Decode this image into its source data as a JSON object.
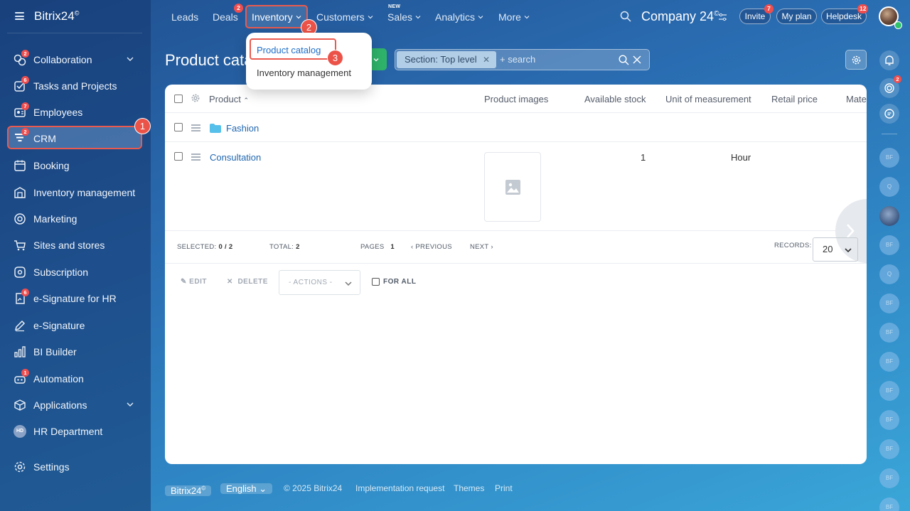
{
  "app": {
    "brand": "Bitrix24",
    "brand_mark": "©"
  },
  "sidebar": {
    "items": [
      {
        "label": "Collaboration",
        "badge": "2",
        "has_chevron": true
      },
      {
        "label": "Tasks and Projects",
        "badge": "6"
      },
      {
        "label": "Employees",
        "badge": "7"
      },
      {
        "label": "CRM",
        "badge": "2",
        "active": true
      },
      {
        "label": "Booking"
      },
      {
        "label": "Inventory management"
      },
      {
        "label": "Marketing"
      },
      {
        "label": "Sites and stores"
      },
      {
        "label": "Subscription"
      },
      {
        "label": "e-Signature for HR",
        "badge": "6"
      },
      {
        "label": "e-Signature"
      },
      {
        "label": "BI Builder"
      },
      {
        "label": "Automation",
        "badge": "1"
      },
      {
        "label": "Applications",
        "has_chevron": true
      },
      {
        "label": "HR Department",
        "avatar": "HD"
      },
      {
        "label": "Settings"
      }
    ]
  },
  "steps": {
    "one": "1",
    "two": "2",
    "three": "3"
  },
  "topnav": {
    "leads": "Leads",
    "deals": "Deals",
    "deals_badge": "2",
    "inventory": "Inventory",
    "customers": "Customers",
    "sales": "Sales",
    "sales_tag": "NEW",
    "analytics": "Analytics",
    "more": "More",
    "company": "Company 24",
    "company_mark": "©",
    "invite": "Invite",
    "invite_badge": "7",
    "my_plan": "My plan",
    "helpdesk": "Helpdesk",
    "helpdesk_badge": "12"
  },
  "dropdown": {
    "items": [
      "Product catalog",
      "Inventory management"
    ]
  },
  "page": {
    "title": "Product catalog",
    "filter_chip": "Section: Top level",
    "search_placeholder": "+ search"
  },
  "grid": {
    "columns": [
      "Product",
      "Product images",
      "Available stock",
      "Unit of measurement",
      "Retail price",
      "Mate"
    ],
    "rows": [
      {
        "name": "Fashion",
        "is_section": true
      },
      {
        "name": "Consultation",
        "available_stock": "1",
        "unit": "Hour"
      }
    ],
    "footer": {
      "selected_label": "SELECTED:",
      "selected_value": "0 / 2",
      "total_label": "TOTAL:",
      "total_value": "2",
      "pages_label": "PAGES",
      "pages_value": "1",
      "previous": "PREVIOUS",
      "next": "NEXT",
      "records_label": "RECORDS:",
      "records_value": "20"
    },
    "actions": {
      "edit": "EDIT",
      "delete": "DELETE",
      "actions_select": "- ACTIONS -",
      "for_all": "FOR ALL"
    }
  },
  "rail": {
    "notifications_badge": "2",
    "contacts": [
      "BF",
      "Q",
      "",
      "BF",
      "Q",
      "BF",
      "BF",
      "BF",
      "BF",
      "BF",
      "BF",
      "BF",
      "BF"
    ]
  },
  "footer": {
    "brand": "Bitrix24",
    "brand_mark": "©",
    "language": "English",
    "copyright": "© 2025 Bitrix24",
    "implementation": "Implementation request",
    "themes": "Themes",
    "print": "Print"
  },
  "colors": {
    "highlight": "#ea5a4e",
    "badge": "#f04e4e",
    "link": "#2067b0",
    "create": "#2fb36a"
  }
}
